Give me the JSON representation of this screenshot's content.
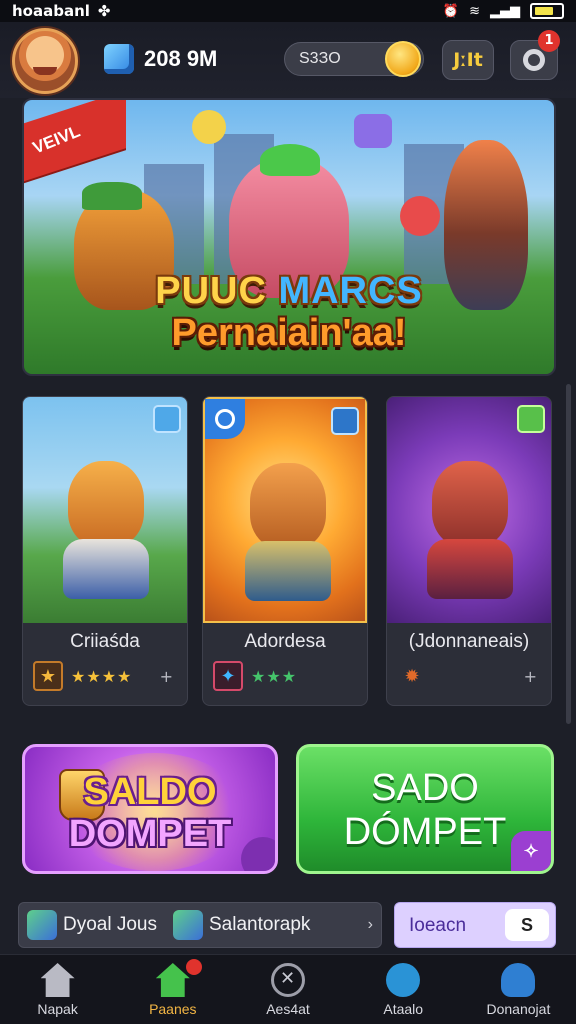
{
  "status_bar": {
    "carrier": "hoaabanl",
    "signal_icons": [
      "alarm-icon",
      "wifi-icon",
      "signal-icon",
      "battery-icon"
    ]
  },
  "header": {
    "gem_count": "208 9M",
    "coin_amount": "S3ЗO",
    "event_button_label": "JːIt",
    "notification_count": "1"
  },
  "hero": {
    "ribbon_text": "VEIVL",
    "title_part1": "PUUC ",
    "title_part2": "MARCS",
    "subtitle": "Pernaiain'aa!"
  },
  "cards": [
    {
      "name": "Criiaśda",
      "stars": "★★★★",
      "plus": "+",
      "icon": "shield-star-icon"
    },
    {
      "name": "Adordesa",
      "stars": "★★★",
      "plus": "",
      "icon": "sparkle-icon"
    },
    {
      "name": "(Jdonnaneais)",
      "stars": "",
      "plus": "+",
      "icon": "fire-icon"
    }
  ],
  "promos": {
    "left_line1": "SALDO",
    "left_line2": "DOMPET",
    "right_line1": "SADO",
    "right_line2": "DÓMPET"
  },
  "ticker": {
    "item1": "Dyoal Jous",
    "item2": "Salantorapk",
    "arrow": "›"
  },
  "search_pill": {
    "label": "Ioeacn",
    "toggle": "S"
  },
  "bottom_nav": [
    {
      "label": "Napak",
      "icon": "home-icon"
    },
    {
      "label": "Paanes",
      "icon": "shop-icon"
    },
    {
      "label": "Aes4at",
      "icon": "battle-icon"
    },
    {
      "label": "Ataalo",
      "icon": "chat-icon"
    },
    {
      "label": "Donanojat",
      "icon": "profile-icon"
    }
  ],
  "colors": {
    "background": "#1d1f28",
    "accent_green": "#2eb53a",
    "accent_purple": "#c560e8",
    "active_tab": "#f2b544"
  }
}
